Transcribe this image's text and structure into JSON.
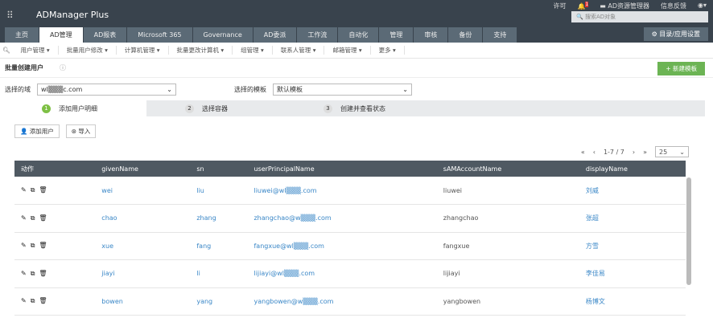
{
  "header": {
    "app_name": "ADManager Plus",
    "links": [
      "许可",
      "AD资源管理器",
      "信息反馈"
    ],
    "notification_count": "1",
    "search_placeholder": "搜索AD对象",
    "settings_label": "目录/应用设置"
  },
  "tabs": [
    "主页",
    "AD管理",
    "AD报表",
    "Microsoft 365",
    "Governance",
    "AD委派",
    "工作流",
    "自动化",
    "管理",
    "审核",
    "备份",
    "支持"
  ],
  "submenu": [
    "用户管理 ▾",
    "批量用户修改 ▾",
    "计算机管理 ▾",
    "批量更改计算机 ▾",
    "组管理 ▾",
    "联系人管理 ▾",
    "邮箱管理 ▾",
    "更多 ▾"
  ],
  "page": {
    "title": "批量创建用户",
    "new_template": "+ 新建模板",
    "domain_label": "选择的域",
    "domain_value": "wl▒▒▒c.com",
    "template_label": "选择的模板",
    "template_value": "默认模板"
  },
  "steps": [
    {
      "n": "1",
      "label": "添加用户明细"
    },
    {
      "n": "2",
      "label": "选择容器"
    },
    {
      "n": "3",
      "label": "创建并查看状态"
    }
  ],
  "actions": {
    "add_user": "添加用户",
    "import": "导入"
  },
  "pager": {
    "range": "1-7 / 7",
    "per_page": "25"
  },
  "columns": [
    "动作",
    "givenName",
    "sn",
    "userPrincipalName",
    "sAMAccountName",
    "displayName"
  ],
  "rows": [
    {
      "given": "wei",
      "sn": "liu",
      "upn": "liuwei@wl▒▒▒.com",
      "sam": "liuwei",
      "display": "刘威"
    },
    {
      "given": "chao",
      "sn": "zhang",
      "upn": "zhangchao@w▒▒▒.com",
      "sam": "zhangchao",
      "display": "张超"
    },
    {
      "given": "xue",
      "sn": "fang",
      "upn": "fangxue@wl▒▒▒.com",
      "sam": "fangxue",
      "display": "方雪"
    },
    {
      "given": "jiayi",
      "sn": "li",
      "upn": "lijiayi@wl▒▒▒.com",
      "sam": "lijiayi",
      "display": "李佳易"
    },
    {
      "given": "bowen",
      "sn": "yang",
      "upn": "yangbowen@w▒▒▒.com",
      "sam": "yangbowen",
      "display": "杨博文"
    }
  ]
}
